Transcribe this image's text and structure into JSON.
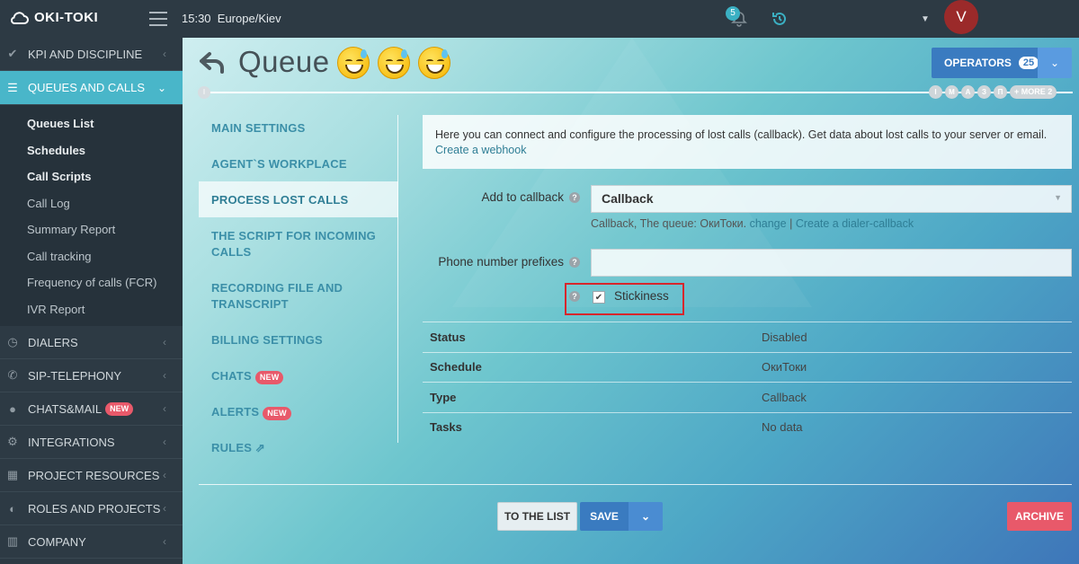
{
  "topbar": {
    "logo_text": "OKI-TOKI",
    "time": "15:30",
    "timezone": "Europe/Kiev",
    "notifications_count": "5",
    "avatar_letter": "V"
  },
  "sidebar": {
    "sections_before": [
      {
        "label": "KPI AND DISCIPLINE",
        "icon": "check-icon"
      }
    ],
    "active_section": {
      "label": "QUEUES AND CALLS",
      "icon": "list-icon"
    },
    "subitems": [
      {
        "label": "Queues List",
        "bold": true
      },
      {
        "label": "Schedules",
        "bold": true
      },
      {
        "label": "Call Scripts",
        "bold": true
      },
      {
        "label": "Call Log",
        "bold": false
      },
      {
        "label": "Summary Report",
        "bold": false
      },
      {
        "label": "Call tracking",
        "bold": false
      },
      {
        "label": "Frequency of calls (FCR)",
        "bold": false
      },
      {
        "label": "IVR Report",
        "bold": false
      }
    ],
    "sections_after": [
      {
        "label": "DIALERS",
        "icon": "clock-icon",
        "badge": ""
      },
      {
        "label": "SIP-TELEPHONY",
        "icon": "phone-icon",
        "badge": ""
      },
      {
        "label": "CHATS&MAIL",
        "icon": "chat-icon",
        "badge": "NEW"
      },
      {
        "label": "INTEGRATIONS",
        "icon": "cogs-icon",
        "badge": ""
      },
      {
        "label": "PROJECT RESOURCES",
        "icon": "grid-icon",
        "badge": ""
      },
      {
        "label": "ROLES AND PROJECTS",
        "icon": "toggle-icon",
        "badge": ""
      },
      {
        "label": "COMPANY",
        "icon": "bar-chart-icon",
        "badge": ""
      }
    ]
  },
  "header": {
    "title": "Queue",
    "operators_label": "OPERATORS",
    "operators_count": "25"
  },
  "timeline": {
    "start": "I",
    "dots": [
      "I",
      "M",
      "A",
      "З",
      "П"
    ],
    "more_label": "+ MORE 2"
  },
  "tabs": [
    {
      "label": "MAIN SETTINGS",
      "active": false,
      "badge": ""
    },
    {
      "label": "AGENT`S WORKPLACE",
      "active": false,
      "badge": ""
    },
    {
      "label": "PROCESS LOST CALLS",
      "active": true,
      "badge": ""
    },
    {
      "label": "THE SCRIPT FOR INCOMING CALLS",
      "active": false,
      "badge": ""
    },
    {
      "label": "RECORDING FILE AND TRANSCRIPT",
      "active": false,
      "badge": ""
    },
    {
      "label": "BILLING SETTINGS",
      "active": false,
      "badge": ""
    },
    {
      "label": "CHATS",
      "active": false,
      "badge": "NEW"
    },
    {
      "label": "ALERTS",
      "active": false,
      "badge": "NEW"
    },
    {
      "label": "RULES",
      "active": false,
      "badge": ""
    }
  ],
  "info": {
    "text": "Here you can connect and configure the processing of lost calls (callback). Get data about lost calls to your server or email.",
    "link": "Create a webhook"
  },
  "form": {
    "callback_label": "Add to callback",
    "callback_value": "Callback",
    "hint_text": "Callback, The queue: ОкиТоки.",
    "hint_change": "change",
    "hint_sep": "|",
    "hint_dialer": "Create a dialer-callback",
    "prefixes_label": "Phone number prefixes",
    "prefixes_value": "",
    "stickiness_label": "Stickiness",
    "stickiness_checked": true
  },
  "details": [
    {
      "key": "Status",
      "value": "Disabled"
    },
    {
      "key": "Schedule",
      "value": "ОкиТоки"
    },
    {
      "key": "Type",
      "value": "Callback"
    },
    {
      "key": "Tasks",
      "value": "No data"
    }
  ],
  "buttons": {
    "to_list": "TO THE LIST",
    "save": "SAVE",
    "archive": "ARCHIVE"
  },
  "colors": {
    "accent": "#49b6c9",
    "primary_button": "#3a7bc0",
    "danger": "#e8596a",
    "sidebar_bg": "#2d3a44"
  }
}
